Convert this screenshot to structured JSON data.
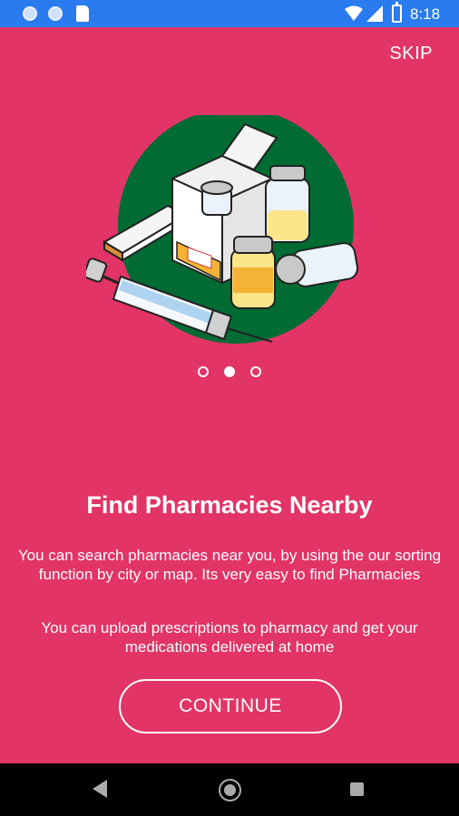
{
  "status_bar": {
    "time": "8:18",
    "background_color": "#2A7BEF"
  },
  "header": {
    "skip_label": "SKIP"
  },
  "onboarding": {
    "page_count": 3,
    "active_page": 2,
    "title": "Find Pharmacies Nearby",
    "description_1": "You can search pharmacies near you, by using the our sorting function by city or map. Its very easy to find Pharmacies",
    "description_2": "You can upload prescriptions to pharmacy and get your medications delivered at home",
    "continue_label": "CONTINUE",
    "illustration_icon": "medicine-supplies-icon"
  },
  "colors": {
    "background": "#E23466",
    "illustration_circle": "#006B33",
    "text": "#FFFFFF"
  },
  "nav_bar": {
    "icons": [
      "back-icon",
      "home-icon",
      "recents-icon"
    ]
  }
}
